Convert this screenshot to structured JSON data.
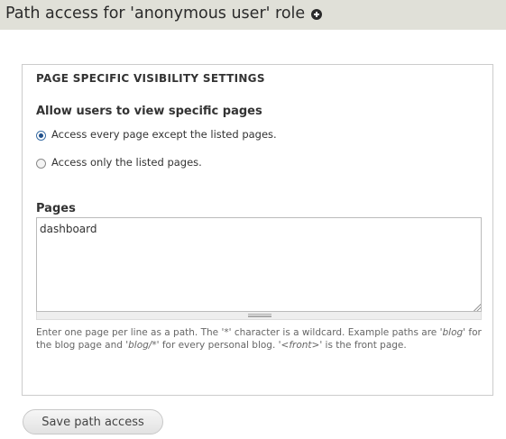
{
  "header": {
    "title": "Path access for 'anonymous user' role",
    "close_icon": "close-icon"
  },
  "fieldset": {
    "legend": "PAGE SPECIFIC VISIBILITY SETTINGS",
    "visibility": {
      "label": "Allow users to view specific pages",
      "options": [
        {
          "label": "Access every page except the listed pages.",
          "checked": true
        },
        {
          "label": "Access only the listed pages.",
          "checked": false
        }
      ]
    },
    "pages": {
      "label": "Pages",
      "value": "dashboard"
    },
    "description": {
      "part1": "Enter one page per line as a path. The '*' character is a wildcard. Example paths are '",
      "em1": "blog",
      "part2": "' for the blog page and '",
      "em2": "blog/*",
      "part3": "' for every personal blog. '",
      "em3": "<front>",
      "part4": "' is the front page."
    }
  },
  "actions": {
    "save_label": "Save path access"
  }
}
